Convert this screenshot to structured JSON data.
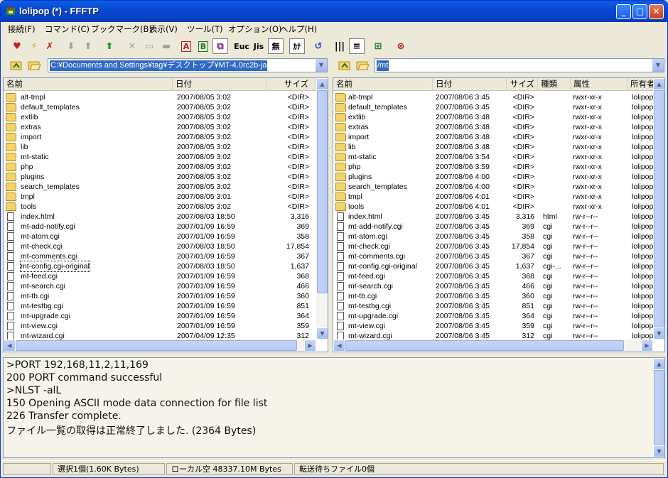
{
  "window": {
    "title": "lolipop (*) - FFFTP"
  },
  "menus": [
    "接続(F)",
    "コマンド(C)",
    "ブックマーク(B)",
    "表示(V)",
    "ツール(T)",
    "オプション(O)",
    "ヘルプ(H)"
  ],
  "toolbar": {
    "ascii_label": "A",
    "binary_label": "B",
    "euc_label": "Euc",
    "jis_label": "Jis",
    "nochange_label": "無",
    "kana_label": "ｶﾅ"
  },
  "local": {
    "path": "C:¥Documents and Settings¥tag¥デスクトップ¥MT-4.0rc2b-ja",
    "headers": [
      "名前",
      "日付",
      "サイズ"
    ],
    "rows": [
      {
        "name": "alt-tmpl",
        "date": "2007/08/05  3:02",
        "size": "<DIR>",
        "type": "dir"
      },
      {
        "name": "default_templates",
        "date": "2007/08/05  3:02",
        "size": "<DIR>",
        "type": "dir"
      },
      {
        "name": "extlib",
        "date": "2007/08/05  3:02",
        "size": "<DIR>",
        "type": "dir"
      },
      {
        "name": "extras",
        "date": "2007/08/05  3:02",
        "size": "<DIR>",
        "type": "dir"
      },
      {
        "name": "import",
        "date": "2007/08/05  3:02",
        "size": "<DIR>",
        "type": "dir"
      },
      {
        "name": "lib",
        "date": "2007/08/05  3:02",
        "size": "<DIR>",
        "type": "dir"
      },
      {
        "name": "mt-static",
        "date": "2007/08/05  3:02",
        "size": "<DIR>",
        "type": "dir"
      },
      {
        "name": "php",
        "date": "2007/08/05  3:02",
        "size": "<DIR>",
        "type": "dir"
      },
      {
        "name": "plugins",
        "date": "2007/08/05  3:02",
        "size": "<DIR>",
        "type": "dir"
      },
      {
        "name": "search_templates",
        "date": "2007/08/05  3:02",
        "size": "<DIR>",
        "type": "dir"
      },
      {
        "name": "tmpl",
        "date": "2007/08/05  3:01",
        "size": "<DIR>",
        "type": "dir"
      },
      {
        "name": "tools",
        "date": "2007/08/05  3:02",
        "size": "<DIR>",
        "type": "dir"
      },
      {
        "name": "index.html",
        "date": "2007/08/03 18:50",
        "size": "3,316",
        "type": "file"
      },
      {
        "name": "mt-add-notify.cgi",
        "date": "2007/01/09 16:59",
        "size": "369",
        "type": "file"
      },
      {
        "name": "mt-atom.cgi",
        "date": "2007/01/09 16:59",
        "size": "358",
        "type": "file"
      },
      {
        "name": "mt-check.cgi",
        "date": "2007/08/03 18:50",
        "size": "17,854",
        "type": "file"
      },
      {
        "name": "mt-comments.cgi",
        "date": "2007/01/09 16:59",
        "size": "367",
        "type": "file"
      },
      {
        "name": "mt-config.cgi-original",
        "date": "2007/08/03 18:50",
        "size": "1,637",
        "type": "file",
        "selected": true
      },
      {
        "name": "mt-feed.cgi",
        "date": "2007/01/09 16:59",
        "size": "368",
        "type": "file"
      },
      {
        "name": "mt-search.cgi",
        "date": "2007/01/09 16:59",
        "size": "466",
        "type": "file"
      },
      {
        "name": "mt-tb.cgi",
        "date": "2007/01/09 16:59",
        "size": "360",
        "type": "file"
      },
      {
        "name": "mt-testbg.cgi",
        "date": "2007/01/09 16:59",
        "size": "851",
        "type": "file"
      },
      {
        "name": "mt-upgrade.cgi",
        "date": "2007/01/09 16:59",
        "size": "364",
        "type": "file"
      },
      {
        "name": "mt-view.cgi",
        "date": "2007/01/09 16:59",
        "size": "359",
        "type": "file"
      },
      {
        "name": "mt-wizard.cgi",
        "date": "2007/04/09 12:35",
        "size": "312",
        "type": "file"
      }
    ]
  },
  "remote": {
    "path": "/mt",
    "headers": [
      "名前",
      "日付",
      "サイズ",
      "種類",
      "属性",
      "所有者"
    ],
    "rows": [
      {
        "name": "alt-tmpl",
        "date": "2007/08/06  3:45",
        "size": "<DIR>",
        "kind": "",
        "attr": "rwxr-xr-x",
        "owner": "lolipop",
        "type": "dir"
      },
      {
        "name": "default_templates",
        "date": "2007/08/06  3:45",
        "size": "<DIR>",
        "kind": "",
        "attr": "rwxr-xr-x",
        "owner": "lolipop",
        "type": "dir"
      },
      {
        "name": "extlib",
        "date": "2007/08/06  3:48",
        "size": "<DIR>",
        "kind": "",
        "attr": "rwxr-xr-x",
        "owner": "lolipop",
        "type": "dir"
      },
      {
        "name": "extras",
        "date": "2007/08/06  3:48",
        "size": "<DIR>",
        "kind": "",
        "attr": "rwxr-xr-x",
        "owner": "lolipop",
        "type": "dir"
      },
      {
        "name": "import",
        "date": "2007/08/06  3:48",
        "size": "<DIR>",
        "kind": "",
        "attr": "rwxr-xr-x",
        "owner": "lolipop",
        "type": "dir"
      },
      {
        "name": "lib",
        "date": "2007/08/06  3:48",
        "size": "<DIR>",
        "kind": "",
        "attr": "rwxr-xr-x",
        "owner": "lolipop",
        "type": "dir"
      },
      {
        "name": "mt-static",
        "date": "2007/08/06  3:54",
        "size": "<DIR>",
        "kind": "",
        "attr": "rwxr-xr-x",
        "owner": "lolipop",
        "type": "dir"
      },
      {
        "name": "php",
        "date": "2007/08/06  3:59",
        "size": "<DIR>",
        "kind": "",
        "attr": "rwxr-xr-x",
        "owner": "lolipop",
        "type": "dir"
      },
      {
        "name": "plugins",
        "date": "2007/08/06  4:00",
        "size": "<DIR>",
        "kind": "",
        "attr": "rwxr-xr-x",
        "owner": "lolipop",
        "type": "dir"
      },
      {
        "name": "search_templates",
        "date": "2007/08/06  4:00",
        "size": "<DIR>",
        "kind": "",
        "attr": "rwxr-xr-x",
        "owner": "lolipop",
        "type": "dir"
      },
      {
        "name": "tmpl",
        "date": "2007/08/06  4:01",
        "size": "<DIR>",
        "kind": "",
        "attr": "rwxr-xr-x",
        "owner": "lolipop",
        "type": "dir"
      },
      {
        "name": "tools",
        "date": "2007/08/06  4:01",
        "size": "<DIR>",
        "kind": "",
        "attr": "rwxr-xr-x",
        "owner": "lolipop",
        "type": "dir"
      },
      {
        "name": "index.html",
        "date": "2007/08/06  3:45",
        "size": "3,316",
        "kind": "html",
        "attr": "rw-r--r--",
        "owner": "lolipop",
        "type": "file"
      },
      {
        "name": "mt-add-notify.cgi",
        "date": "2007/08/06  3:45",
        "size": "369",
        "kind": "cgi",
        "attr": "rw-r--r--",
        "owner": "lolipop",
        "type": "file"
      },
      {
        "name": "mt-atom.cgi",
        "date": "2007/08/06  3:45",
        "size": "358",
        "kind": "cgi",
        "attr": "rw-r--r--",
        "owner": "lolipop",
        "type": "file"
      },
      {
        "name": "mt-check.cgi",
        "date": "2007/08/06  3:45",
        "size": "17,854",
        "kind": "cgi",
        "attr": "rw-r--r--",
        "owner": "lolipop",
        "type": "file"
      },
      {
        "name": "mt-comments.cgi",
        "date": "2007/08/06  3:45",
        "size": "367",
        "kind": "cgi",
        "attr": "rw-r--r--",
        "owner": "lolipop",
        "type": "file"
      },
      {
        "name": "mt-config.cgi-original",
        "date": "2007/08/06  3:45",
        "size": "1,637",
        "kind": "cgi-...",
        "attr": "rw-r--r--",
        "owner": "lolipop",
        "type": "file"
      },
      {
        "name": "mt-feed.cgi",
        "date": "2007/08/06  3:45",
        "size": "368",
        "kind": "cgi",
        "attr": "rw-r--r--",
        "owner": "lolipop",
        "type": "file"
      },
      {
        "name": "mt-search.cgi",
        "date": "2007/08/06  3:45",
        "size": "466",
        "kind": "cgi",
        "attr": "rw-r--r--",
        "owner": "lolipop",
        "type": "file"
      },
      {
        "name": "mt-tb.cgi",
        "date": "2007/08/06  3:45",
        "size": "360",
        "kind": "cgi",
        "attr": "rw-r--r--",
        "owner": "lolipop",
        "type": "file"
      },
      {
        "name": "mt-testbg.cgi",
        "date": "2007/08/06  3:45",
        "size": "851",
        "kind": "cgi",
        "attr": "rw-r--r--",
        "owner": "lolipop",
        "type": "file"
      },
      {
        "name": "mt-upgrade.cgi",
        "date": "2007/08/06  3:45",
        "size": "364",
        "kind": "cgi",
        "attr": "rw-r--r--",
        "owner": "lolipop",
        "type": "file"
      },
      {
        "name": "mt-view.cgi",
        "date": "2007/08/06  3:45",
        "size": "359",
        "kind": "cgi",
        "attr": "rw-r--r--",
        "owner": "lolipop",
        "type": "file"
      },
      {
        "name": "mt-wizard.cgi",
        "date": "2007/08/06  3:45",
        "size": "312",
        "kind": "cgi",
        "attr": "rw-r--r--",
        "owner": "lolipop",
        "type": "file"
      }
    ]
  },
  "log": [
    ">PORT 192,168,11,2,11,169",
    "200 PORT command successful",
    ">NLST -alL",
    "150 Opening ASCII mode data connection for file list",
    "226 Transfer complete.",
    "ファイル一覧の取得は正常終了しました. (2364 Bytes)"
  ],
  "status": {
    "selection": "選択1個(1.60K Bytes)",
    "local_free": "ローカル空 48337.10M Bytes",
    "queue": "転送待ちファイル0個"
  },
  "colors": {
    "selection": "#316ac5",
    "titlebar": "#0a4ad4"
  }
}
